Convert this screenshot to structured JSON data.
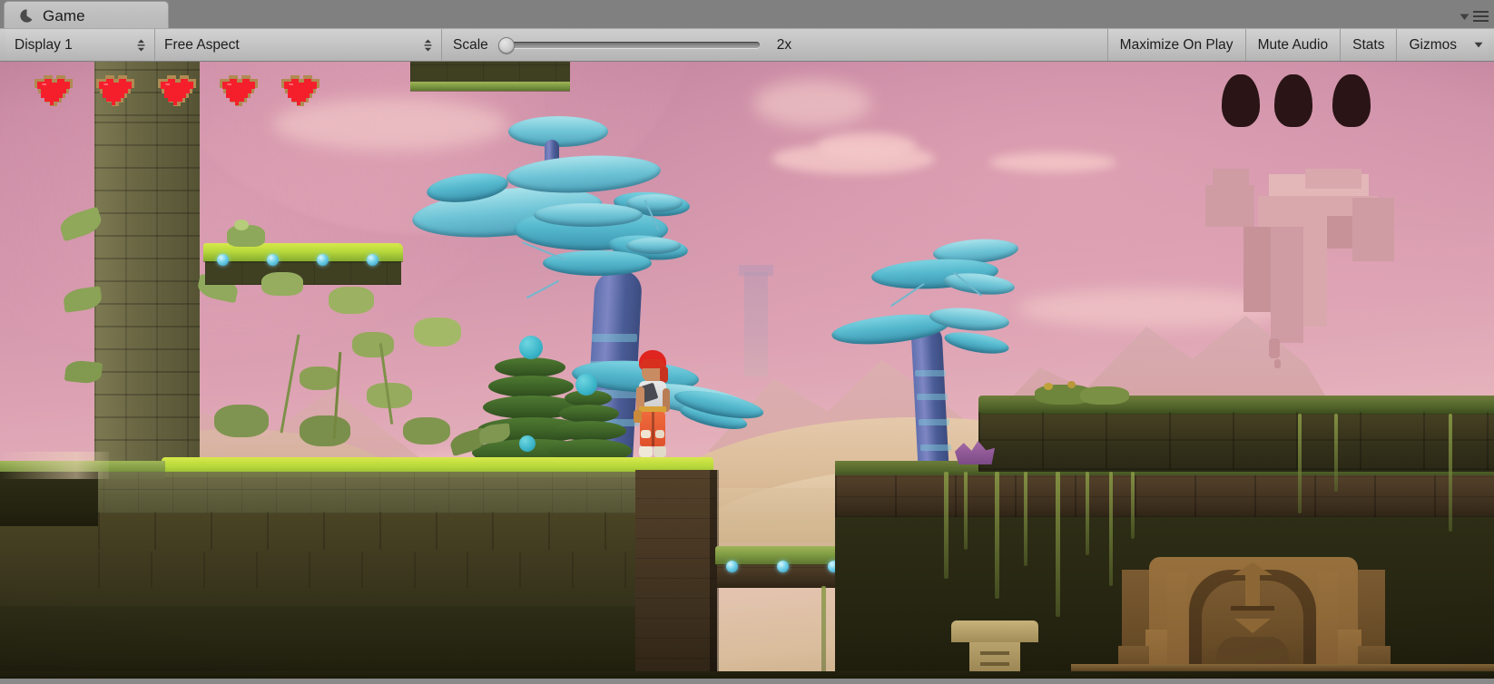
{
  "window": {
    "tab_label": "Game",
    "tab_icon": "unity-game-view-icon",
    "options_icon": "chevron-down-icon",
    "menu_icon": "hamburger-menu-icon"
  },
  "toolbar": {
    "display_select": {
      "value": "Display 1",
      "icon": "updown-arrows-icon"
    },
    "aspect_select": {
      "value": "Free Aspect",
      "icon": "updown-arrows-icon"
    },
    "scale": {
      "label": "Scale",
      "value": "2x",
      "thumb_position_pct": 0
    },
    "maximize_on_play": "Maximize On Play",
    "mute_audio": "Mute Audio",
    "stats": "Stats",
    "gizmos": "Gizmos",
    "gizmos_arrow_icon": "chevron-down-icon"
  },
  "game": {
    "scene_name": "platformer-alien-world",
    "hud": {
      "hearts_count": 5,
      "heart_icon": "heart-icon",
      "heart_color": "#f51f2c",
      "heart_border_color": "#b08b52",
      "orbs_count": 3,
      "orb_icon": "dark-orb-icon",
      "orb_color": "#2a1416"
    },
    "palette": {
      "sky_top": "#c07f9d",
      "sky_mid": "#dda3b4",
      "sky_horizon": "#e8bdbe",
      "desert": "#d9bd9c",
      "cloud": "#f3c7c7",
      "alien_tree_cap": "#55b8cd",
      "alien_tree_trunk": "#6b74b2",
      "grass_bright": "#c3de42",
      "grass_dim": "#7e9a42",
      "rock": "#6b6a42",
      "dirt_dark": "#33301a",
      "temple_stone": "#7a5a31",
      "gem": "#6fd0e8",
      "character_hair": "#e0241f",
      "character_pants": "#e8603a",
      "character_shirt": "#e8e8e8",
      "floating_ruin": "#d9a8ad"
    }
  }
}
